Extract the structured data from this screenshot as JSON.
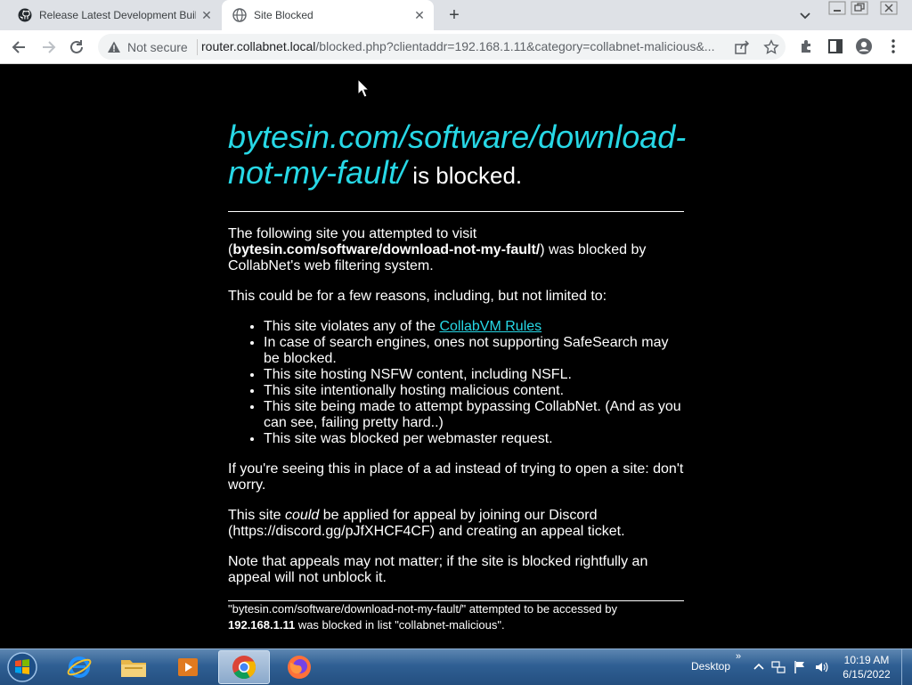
{
  "browser": {
    "tabs": [
      {
        "title": "Release Latest Development Build",
        "state": "inactive",
        "icon": "github-icon"
      },
      {
        "title": "Site Blocked",
        "state": "active",
        "icon": "globe-icon"
      }
    ],
    "new_tab_label": "+",
    "close_glyph": "✕",
    "security_label": "Not secure",
    "url_host": "router.collabnet.local",
    "url_rest": "/blocked.php?clientaddr=192.168.1.11&category=collabnet-malicious&..."
  },
  "page": {
    "heading_site": "bytesin.com/software/download-not-my-fault/",
    "heading_suffix": " is blocked.",
    "p1_before": "The following site you attempted to visit (",
    "p1_site": "bytesin.com/software/download-not-my-fault/",
    "p1_after": ") was blocked by CollabNet's web filtering system.",
    "p2": "This could be for a few reasons, including, but not limited to:",
    "reasons_first_prefix": "This site violates any of the ",
    "reasons_first_link": "CollabVM Rules",
    "reasons": [
      "In case of search engines, ones not supporting SafeSearch may be blocked.",
      "This site hosting NSFW content, including NSFL.",
      "This site intentionally hosting malicious content.",
      "This site being made to attempt bypassing CollabNet. (And as you can see, failing pretty hard..)",
      "This site was blocked per webmaster request."
    ],
    "p3": "If you're seeing this in place of a ad instead of trying to open a site: don't worry.",
    "p4_before": "This site ",
    "p4_em": "could",
    "p4_after": " be applied for appeal by joining our Discord (https://discord.gg/pJfXHCF4CF) and creating an appeal ticket.",
    "p5": "Note that appeals may not matter; if the site is blocked rightfully an appeal will not unblock it.",
    "footer_line1": "\"bytesin.com/software/download-not-my-fault/\" attempted to be accessed by",
    "footer_ip": "192.168.1.11",
    "footer_line2": " was blocked in list \"collabnet-malicious\"."
  },
  "taskbar": {
    "apps": [
      "internet-explorer-icon",
      "file-explorer-icon",
      "media-player-icon",
      "chrome-icon",
      "firefox-icon"
    ],
    "active_app": "chrome-icon",
    "desktop_label": "Desktop",
    "overflow_glyph": "»",
    "time": "10:19 AM",
    "date": "6/15/2022"
  },
  "colors": {
    "link": "#27d8e6",
    "page_bg": "#000000",
    "tabbar_bg": "#dee1e6"
  }
}
